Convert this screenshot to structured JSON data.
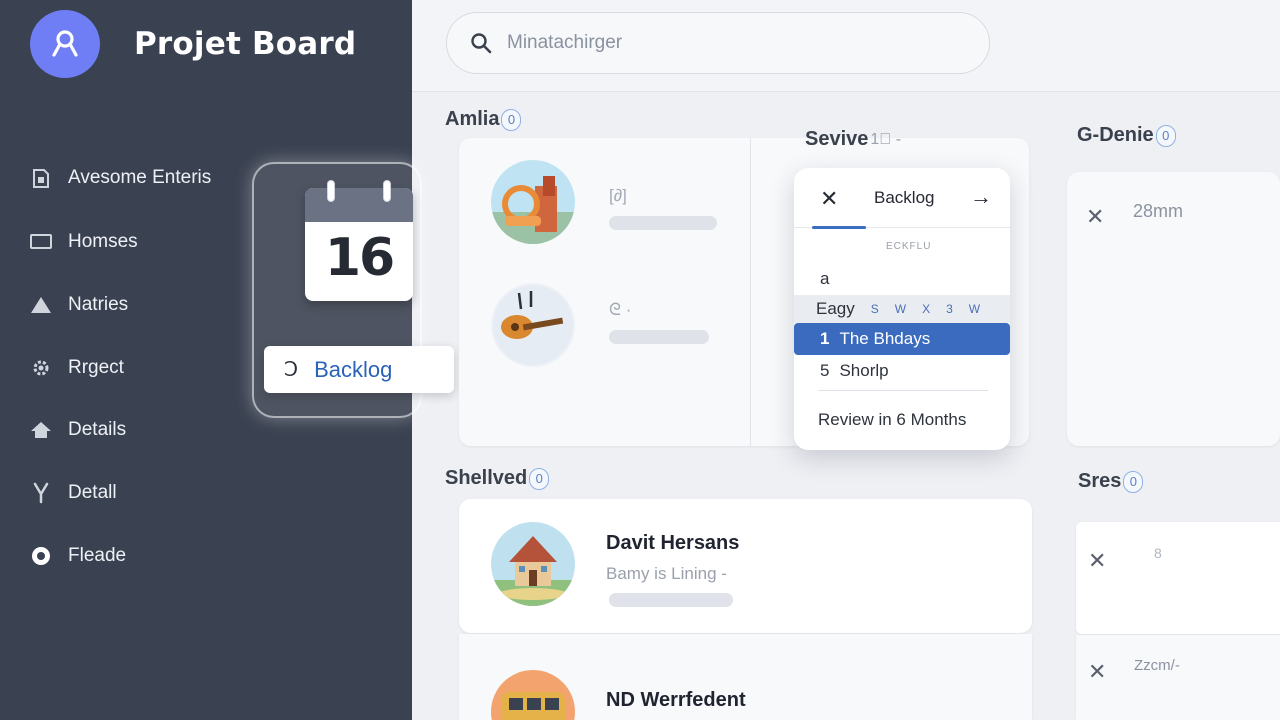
{
  "app": {
    "title": "Projet Board"
  },
  "sidebar": {
    "items": [
      {
        "label": "Avesome Enteris",
        "icon": "document-icon"
      },
      {
        "label": "Homses",
        "icon": "window-icon"
      },
      {
        "label": "Natries",
        "icon": "triangle-icon"
      },
      {
        "label": "Rrgect",
        "icon": "gear-icon"
      },
      {
        "label": "Details",
        "icon": "home-icon"
      },
      {
        "label": "Detall",
        "icon": "flask-icon"
      },
      {
        "label": "Fleade",
        "icon": "radio-icon"
      }
    ]
  },
  "calendar": {
    "day": "16"
  },
  "backlog_pill": {
    "symbol": "Ↄ",
    "label": "Backlog"
  },
  "search": {
    "placeholder": "Minatachirger"
  },
  "columns": {
    "amlia": {
      "title": "Amlia",
      "count": "0"
    },
    "sevive": {
      "title": "Sevive",
      "suffix": "1⃠ -"
    },
    "gdenie": {
      "title": "G-Denie",
      "count": "0"
    },
    "shellved": {
      "title": "Shellved",
      "count": "0"
    },
    "sres": {
      "title": "Sres",
      "count": "0"
    }
  },
  "amlia_cards": [
    {
      "ghost": "[∂]"
    },
    {
      "ghost": "ᘓ ·"
    }
  ],
  "popover": {
    "title": "Backlog",
    "caption": "ECKFLU",
    "row_a": "a",
    "days_label": "Eagy",
    "days": [
      "S",
      "W",
      "X",
      "3",
      "W"
    ],
    "selected": {
      "num": "1",
      "label": "The Bhdays"
    },
    "row_5": {
      "num": "5",
      "label": "Shorlp"
    },
    "footer": "Review in 6 Months"
  },
  "gdenie_card": {
    "meta": "28mm"
  },
  "shellved_cards": [
    {
      "name": "Davit Hersans",
      "subtitle": "Bamy is Lining -"
    },
    {
      "name": "ND Werrfedent"
    }
  ],
  "sres_cards": [
    {
      "meta": "8"
    },
    {
      "meta": "Zzcm/-"
    }
  ]
}
